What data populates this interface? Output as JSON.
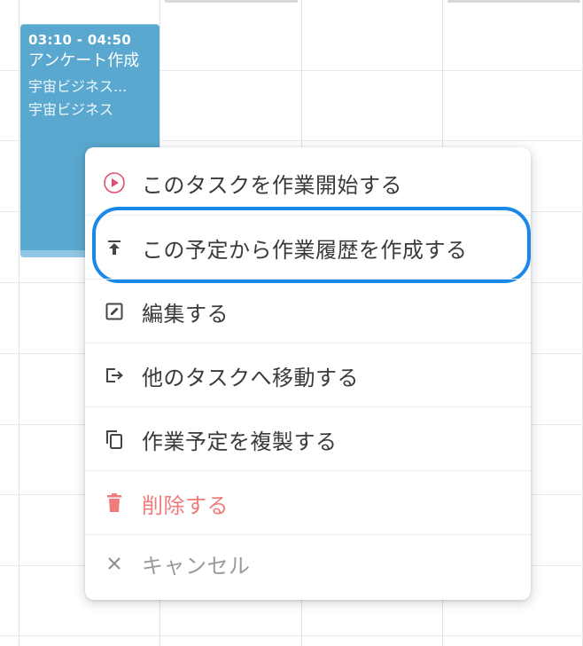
{
  "event": {
    "time": "03:10 - 04:50",
    "title": "アンケート作成",
    "subtitle_1": "宇宙ビジネス...",
    "subtitle_2": "宇宙ビジネス"
  },
  "context_menu": {
    "items": [
      {
        "id": "start",
        "label": "このタスクを作業開始する",
        "icon": "play-circle-icon"
      },
      {
        "id": "create_history",
        "label": "この予定から作業履歴を作成する",
        "icon": "upload-icon",
        "highlighted": true
      },
      {
        "id": "edit",
        "label": "編集する",
        "icon": "edit-icon"
      },
      {
        "id": "move",
        "label": "他のタスクへ移動する",
        "icon": "move-out-icon"
      },
      {
        "id": "duplicate",
        "label": "作業予定を複製する",
        "icon": "copy-icon"
      },
      {
        "id": "delete",
        "label": "削除する",
        "icon": "trash-icon"
      },
      {
        "id": "cancel",
        "label": "キャンセル",
        "icon": "close-icon"
      }
    ]
  },
  "colors": {
    "event_bg": "#5aa8cf",
    "highlight": "#1a88e8",
    "danger": "#f07b7b",
    "play_icon": "#e0506e"
  }
}
